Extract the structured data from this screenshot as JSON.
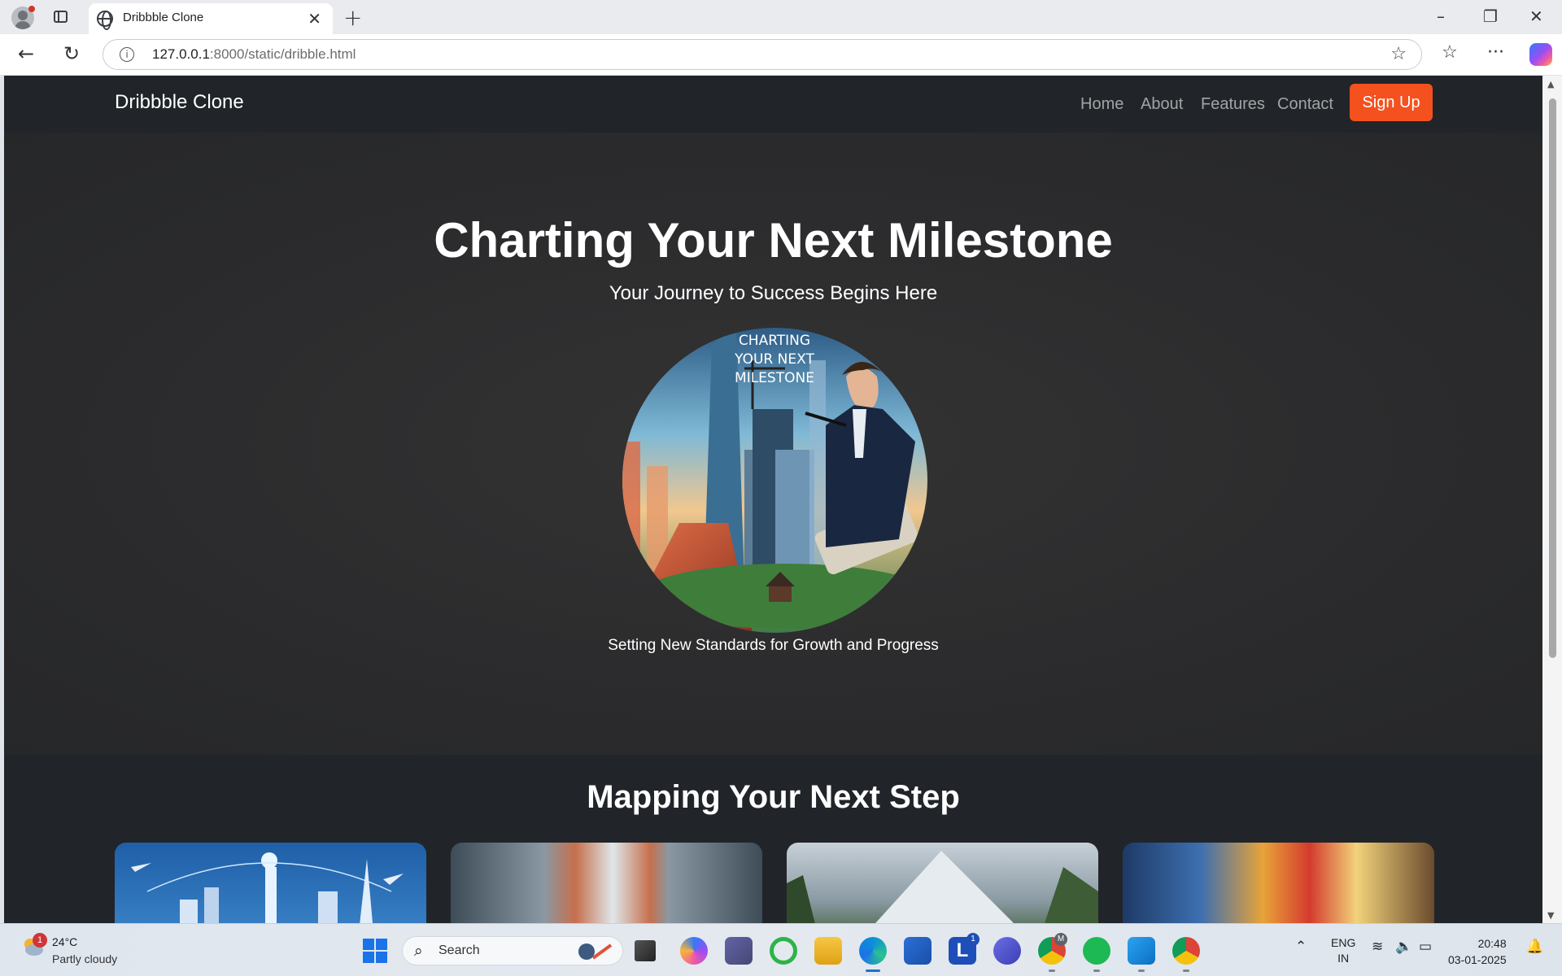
{
  "browser": {
    "tab_title": "Dribbble Clone",
    "tab_close": "✕",
    "new_tab": "+",
    "url_host": "127.0.0.1",
    "url_path": ":8000/static/dribble.html",
    "info_glyph": "i",
    "icons": [
      "profile-icon",
      "tabs-icon",
      "globe-icon",
      "back-icon",
      "reload-icon",
      "star-icon",
      "favorites-icon",
      "more-icon",
      "copilot-icon"
    ],
    "controls": {
      "minimize": "–",
      "restore": "❐",
      "close": "✕"
    }
  },
  "site": {
    "brand": "Dribbble Clone",
    "nav": [
      "Home",
      "About",
      "Features",
      "Contact"
    ],
    "signup": "Sign Up",
    "accent": "#f4511e",
    "nav_bg": "#212529"
  },
  "hero": {
    "title": "Charting Your Next Milestone",
    "subtitle": "Your Journey to Success Begins Here",
    "image_text": [
      "CHARTING",
      "YOUR NEXT",
      "MILESTONE"
    ],
    "caption": "Setting New Standards for Growth and Progress"
  },
  "mapping": {
    "title": "Mapping Your Next Step",
    "cards": [
      "futuristic-city-card",
      "doorway-card",
      "mountain-card",
      "industrial-color-card"
    ]
  },
  "taskbar": {
    "weather_badge": "1",
    "weather_temp": "24°C",
    "weather_desc": "Partly cloudy",
    "search_placeholder": "Search",
    "apps": [
      "file-stack-icon",
      "copilot-icon",
      "teams-icon",
      "ring-app-icon",
      "file-explorer-icon",
      "edge-icon",
      "store-icon",
      "linkedin-icon",
      "azure-icon",
      "chrome-icon",
      "spotify-icon",
      "vscode-icon",
      "chrome-icon"
    ],
    "linkedin_badge": "1",
    "chrome_badge": "M",
    "lang_top": "ENG",
    "lang_bottom": "IN",
    "time": "20:48",
    "date": "03-01-2025"
  }
}
